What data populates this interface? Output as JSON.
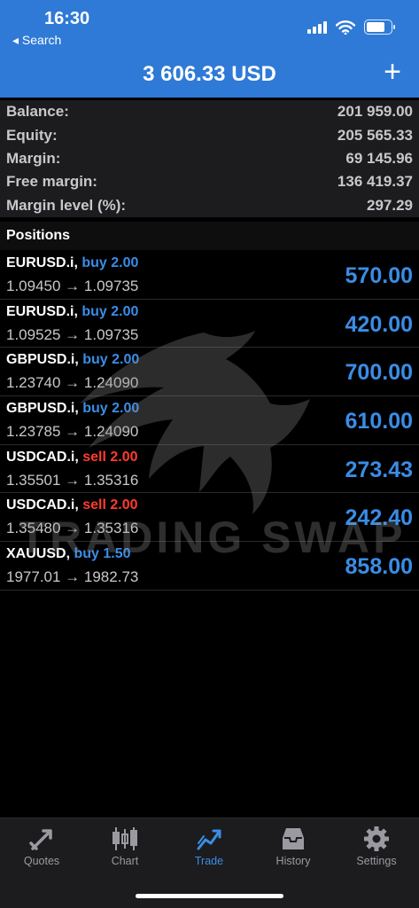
{
  "status": {
    "time": "16:30",
    "back_label": "◂ Search"
  },
  "header": {
    "title": "3 606.33 USD",
    "add_label": "+"
  },
  "summary": [
    {
      "label": "Balance:",
      "value": "201 959.00"
    },
    {
      "label": "Equity:",
      "value": "205 565.33"
    },
    {
      "label": "Margin:",
      "value": "69 145.96"
    },
    {
      "label": "Free margin:",
      "value": "136 419.37"
    },
    {
      "label": "Margin level (%):",
      "value": "297.29"
    }
  ],
  "positions_title": "Positions",
  "positions": [
    {
      "symbol": "EURUSD.i,",
      "side": "buy 2.00",
      "side_type": "buy",
      "prices": "1.09450 → 1.09735",
      "profit": "570.00"
    },
    {
      "symbol": "EURUSD.i,",
      "side": "buy 2.00",
      "side_type": "buy",
      "prices": "1.09525 → 1.09735",
      "profit": "420.00"
    },
    {
      "symbol": "GBPUSD.i,",
      "side": "buy 2.00",
      "side_type": "buy",
      "prices": "1.23740 → 1.24090",
      "profit": "700.00"
    },
    {
      "symbol": "GBPUSD.i,",
      "side": "buy 2.00",
      "side_type": "buy",
      "prices": "1.23785 → 1.24090",
      "profit": "610.00"
    },
    {
      "symbol": "USDCAD.i,",
      "side": "sell 2.00",
      "side_type": "sell",
      "prices": "1.35501 → 1.35316",
      "profit": "273.43"
    },
    {
      "symbol": "USDCAD.i,",
      "side": "sell 2.00",
      "side_type": "sell",
      "prices": "1.35480 → 1.35316",
      "profit": "242.40"
    },
    {
      "symbol": "XAUUSD,",
      "side": "buy 1.50",
      "side_type": "buy",
      "prices": "1977.01 → 1982.73",
      "profit": "858.00"
    }
  ],
  "watermark": {
    "text": "TRADING SWAP"
  },
  "tabs": [
    {
      "label": "Quotes",
      "icon": "quotes-icon",
      "active": false
    },
    {
      "label": "Chart",
      "icon": "chart-icon",
      "active": false
    },
    {
      "label": "Trade",
      "icon": "trade-icon",
      "active": true
    },
    {
      "label": "History",
      "icon": "history-icon",
      "active": false
    },
    {
      "label": "Settings",
      "icon": "settings-gear-icon",
      "active": false
    }
  ],
  "colors": {
    "header_blue": "#2f7ad6",
    "profit_blue": "#3a8de6",
    "sell_red": "#ff3b30",
    "summary_bg": "#1c1c1e",
    "tab_inactive": "#9a9aa0"
  }
}
